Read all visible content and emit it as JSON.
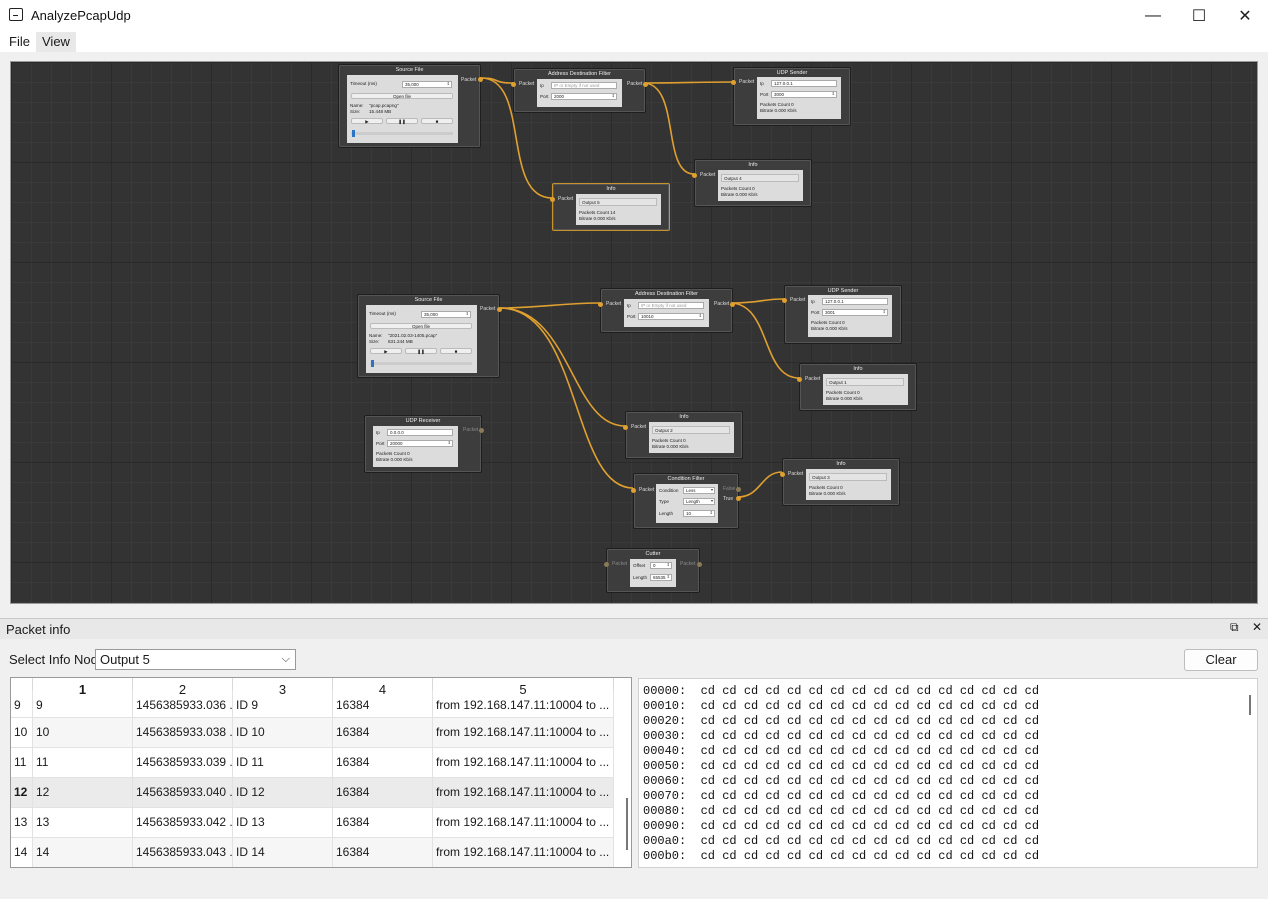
{
  "window": {
    "title": "AnalyzePcapUdp",
    "minimize": "—",
    "maximize": "☐",
    "close": "✕"
  },
  "menu": {
    "file": "File",
    "view": "View"
  },
  "nodes": {
    "source1": {
      "title": "Source File",
      "timeout_label": "Timeout (ms)",
      "timeout_value": "35,000",
      "open_btn": "Open file",
      "name_label": "Name:",
      "name_value": "\"pcap.pcapng\"",
      "size_label": "Size:",
      "size_value": "15.448 MB",
      "port_out": "Packet"
    },
    "filter1": {
      "title": "Address Destination Filter",
      "ip_label": "Ip",
      "ip_placeholder": "IP or Empty if not used",
      "port_label": "Port",
      "port_value": "2000",
      "port_in": "Packet",
      "port_out": "Packet"
    },
    "sender1": {
      "title": "UDP Sender",
      "ip_label": "Ip",
      "ip_value": "127.0.0.1",
      "port_label": "Port",
      "port_value": "3000",
      "count": "Packets Count 0",
      "bitrate": "Bitrate      0.000 Kb/s",
      "port_in": "Packet"
    },
    "info4": {
      "title": "Info",
      "output": "Output 4",
      "count": "Packets Count 0",
      "bitrate": "Bitrate      0.000 Kb/s",
      "port_in": "Packet"
    },
    "info5": {
      "title": "Info",
      "output": "Output 5",
      "count": "Packets Count 14",
      "bitrate": "Bitrate      0.000 Kb/s",
      "port_in": "Packet"
    },
    "source2": {
      "title": "Source File",
      "timeout_label": "Timeout (ms)",
      "timeout_value": "35,000",
      "open_btn": "Open file",
      "name_label": "Name:",
      "name_value": "\"2021.02.03-1405.pcap\"",
      "size_label": "Size:",
      "size_value": "631.244 MB",
      "port_out": "Packet"
    },
    "filter2": {
      "title": "Address Destination Filter",
      "ip_label": "Ip",
      "ip_placeholder": "IP or Empty if not used",
      "port_label": "Port",
      "port_value": "10010",
      "port_in": "Packet",
      "port_out": "Packet"
    },
    "sender2": {
      "title": "UDP Sender",
      "ip_label": "Ip",
      "ip_value": "127.0.0.1",
      "port_label": "Port",
      "port_value": "3001",
      "count": "Packets Count 0",
      "bitrate": "Bitrate      0.000 Kb/s",
      "port_in": "Packet"
    },
    "info1": {
      "title": "Info",
      "output": "Output 1",
      "count": "Packets Count 0",
      "bitrate": "Bitrate      0.000 Kb/s",
      "port_in": "Packet"
    },
    "receiver": {
      "title": "UDP Receiver",
      "ip_label": "Ip",
      "ip_value": "0.0.0.0",
      "port_label": "Port",
      "port_value": "20000",
      "count": "Packets Count 0",
      "bitrate": "Bitrate      0.000 Kb/s",
      "port_out": "Packet"
    },
    "info2": {
      "title": "Info",
      "output": "Output 2",
      "count": "Packets Count 0",
      "bitrate": "Bitrate      0.000 Kb/s",
      "port_in": "Packet"
    },
    "condition": {
      "title": "Condition Filter",
      "cond_label": "Condition",
      "cond_value": "Less",
      "type_label": "Type",
      "type_value": "Length",
      "length_label": "Length",
      "length_value": "10",
      "port_in": "Packet",
      "port_false": "False",
      "port_true": "True"
    },
    "info3": {
      "title": "Info",
      "output": "Output 3",
      "count": "Packets Count 0",
      "bitrate": "Bitrate      0.000 Kb/s",
      "port_in": "Packet"
    },
    "cutter": {
      "title": "Cutter",
      "offset_label": "Offset",
      "offset_value": "0",
      "length_label": "Length",
      "length_value": "65535",
      "port_in": "Packet",
      "port_out": "Packet"
    }
  },
  "panel": {
    "title": "Packet info",
    "restore_icon": "⧉",
    "close_icon": "✕"
  },
  "select_label": "Select Info Node",
  "select_value": "Output 5",
  "clear_label": "Clear",
  "table": {
    "headers": [
      "1",
      "2",
      "3",
      "4",
      "5"
    ],
    "rows": [
      {
        "num": "9",
        "c1": "9",
        "c2": "1456385933.036 ...",
        "c3": "ID 9",
        "c4": "16384",
        "c5": "from 192.168.147.11:10004 to ..."
      },
      {
        "num": "10",
        "c1": "10",
        "c2": "1456385933.038 ...",
        "c3": "ID 10",
        "c4": "16384",
        "c5": "from 192.168.147.11:10004 to ..."
      },
      {
        "num": "11",
        "c1": "11",
        "c2": "1456385933.039 ...",
        "c3": "ID 11",
        "c4": "16384",
        "c5": "from 192.168.147.11:10004 to ..."
      },
      {
        "num": "12",
        "c1": "12",
        "c2": "1456385933.040 ...",
        "c3": "ID 12",
        "c4": "16384",
        "c5": "from 192.168.147.11:10004 to ..."
      },
      {
        "num": "13",
        "c1": "13",
        "c2": "1456385933.042 ...",
        "c3": "ID 13",
        "c4": "16384",
        "c5": "from 192.168.147.11:10004 to ..."
      },
      {
        "num": "14",
        "c1": "14",
        "c2": "1456385933.043 ...",
        "c3": "ID 14",
        "c4": "16384",
        "c5": "from 192.168.147.11:10004 to ..."
      }
    ]
  },
  "hex_lines": [
    "00000:  cd cd cd cd cd cd cd cd cd cd cd cd cd cd cd cd",
    "00010:  cd cd cd cd cd cd cd cd cd cd cd cd cd cd cd cd",
    "00020:  cd cd cd cd cd cd cd cd cd cd cd cd cd cd cd cd",
    "00030:  cd cd cd cd cd cd cd cd cd cd cd cd cd cd cd cd",
    "00040:  cd cd cd cd cd cd cd cd cd cd cd cd cd cd cd cd",
    "00050:  cd cd cd cd cd cd cd cd cd cd cd cd cd cd cd cd",
    "00060:  cd cd cd cd cd cd cd cd cd cd cd cd cd cd cd cd",
    "00070:  cd cd cd cd cd cd cd cd cd cd cd cd cd cd cd cd",
    "00080:  cd cd cd cd cd cd cd cd cd cd cd cd cd cd cd cd",
    "00090:  cd cd cd cd cd cd cd cd cd cd cd cd cd cd cd cd",
    "000a0:  cd cd cd cd cd cd cd cd cd cd cd cd cd cd cd cd",
    "000b0:  cd cd cd cd cd cd cd cd cd cd cd cd cd cd cd cd"
  ],
  "colors": {
    "wire": "#e0a030",
    "canvas": "#333333",
    "node": "#3d3d3d",
    "accent": "#2a73c6"
  }
}
